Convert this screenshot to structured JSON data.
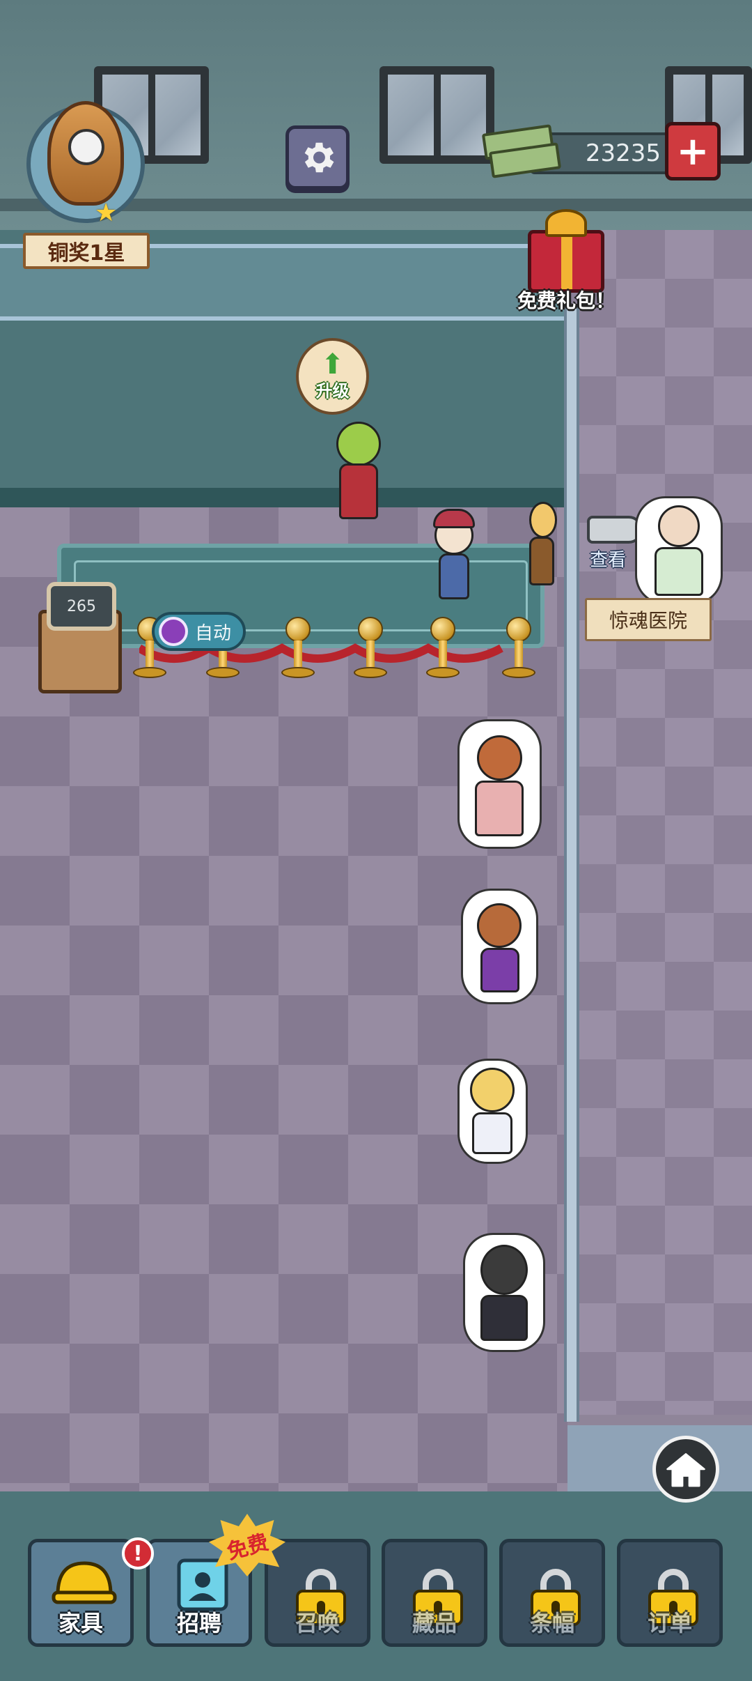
{
  "hud": {
    "rank_label": "铜奖1星",
    "currency_amount": "23235",
    "add_currency_symbol": "+",
    "gift_label": "免费礼包！",
    "upgrade_label": "升级",
    "upgrade_arrow": "⬆"
  },
  "scene": {
    "machine_counter": "265",
    "auto_label": "自动",
    "camera_label": "查看",
    "location_label": "惊魂医院"
  },
  "toolbar": {
    "alert_symbol": "!",
    "free_badge": "免费",
    "items": [
      {
        "label": "家具",
        "locked": false
      },
      {
        "label": "招聘",
        "locked": false
      },
      {
        "label": "召唤",
        "locked": true
      },
      {
        "label": "藏品",
        "locked": true
      },
      {
        "label": "条幅",
        "locked": true
      },
      {
        "label": "订单",
        "locked": true
      }
    ]
  },
  "colors": {
    "floor": "#978ca2",
    "counter": "#4e7579",
    "currency_plus": "#cf3a3f",
    "lock": "#f5c518"
  },
  "icons": [
    "trophy-icon",
    "gear-icon",
    "money-icon",
    "gift-icon",
    "upgrade-arrow-icon",
    "camera-icon",
    "home-icon",
    "lock-icon",
    "helmet-icon",
    "id-card-icon"
  ]
}
